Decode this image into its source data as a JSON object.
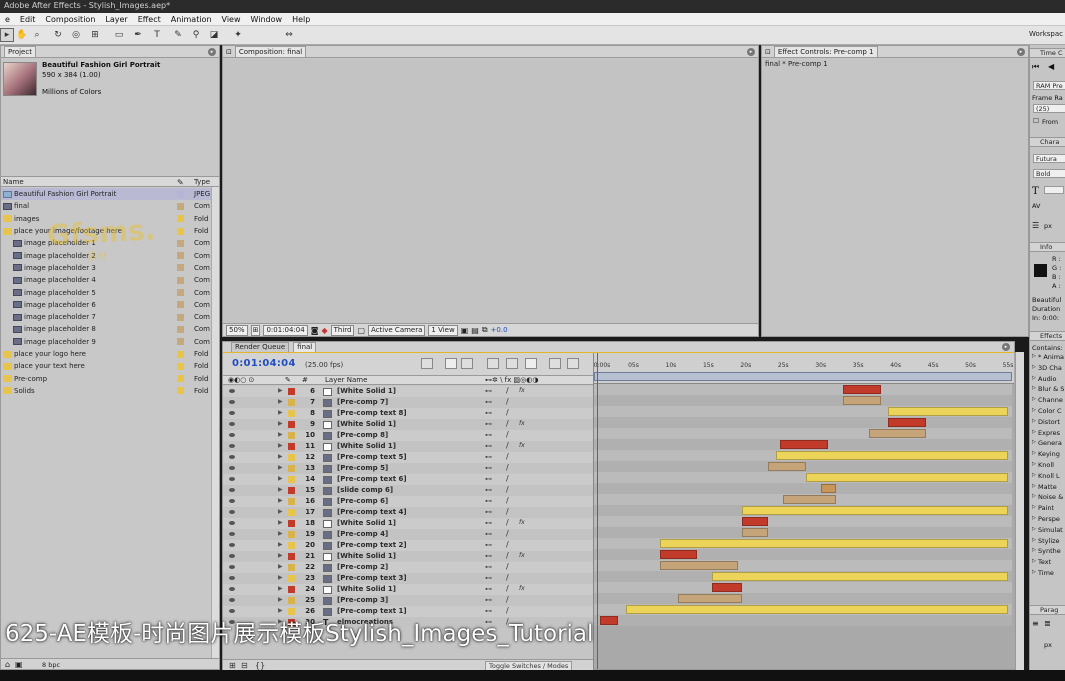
{
  "app": {
    "title": "Adobe After Effects - Stylish_Images.aep*"
  },
  "menu": [
    "e",
    "Edit",
    "Composition",
    "Layer",
    "Effect",
    "Animation",
    "View",
    "Window",
    "Help"
  ],
  "toolbar": {
    "workspace_label": "Workspac"
  },
  "project": {
    "tab": "Project",
    "selected_name": "Beautiful Fashion Girl Portrait",
    "selected_dims": "590 x 384 (1.00)",
    "selected_colors": "Millions of Colors",
    "col_name": "Name",
    "col_type": "Type",
    "bpc": "8 bpc",
    "items": [
      {
        "name": "Beautiful Fashion Girl Portrait",
        "type": "JPEG",
        "kind": "img",
        "indent": 0,
        "label": "#b7b2d8"
      },
      {
        "name": "final",
        "type": "Com",
        "kind": "comp",
        "indent": 0,
        "label": "#c4a87e"
      },
      {
        "name": "images",
        "type": "Fold",
        "kind": "folder",
        "indent": 0,
        "label": "#e8c44a"
      },
      {
        "name": "place your image/footage here",
        "type": "Fold",
        "kind": "folder",
        "indent": 0,
        "label": "#e8c44a"
      },
      {
        "name": "image placeholder 1",
        "type": "Com",
        "kind": "comp",
        "indent": 1,
        "label": "#c4a87e"
      },
      {
        "name": "image placeholder 2",
        "type": "Com",
        "kind": "comp",
        "indent": 1,
        "label": "#c4a87e"
      },
      {
        "name": "image placeholder 3",
        "type": "Com",
        "kind": "comp",
        "indent": 1,
        "label": "#c4a87e"
      },
      {
        "name": "image placeholder 4",
        "type": "Com",
        "kind": "comp",
        "indent": 1,
        "label": "#c4a87e"
      },
      {
        "name": "image placeholder 5",
        "type": "Com",
        "kind": "comp",
        "indent": 1,
        "label": "#c4a87e"
      },
      {
        "name": "image placeholder 6",
        "type": "Com",
        "kind": "comp",
        "indent": 1,
        "label": "#c4a87e"
      },
      {
        "name": "image placeholder 7",
        "type": "Com",
        "kind": "comp",
        "indent": 1,
        "label": "#c4a87e"
      },
      {
        "name": "image placeholder 8",
        "type": "Com",
        "kind": "comp",
        "indent": 1,
        "label": "#c4a87e"
      },
      {
        "name": "image placeholder 9",
        "type": "Com",
        "kind": "comp",
        "indent": 1,
        "label": "#c4a87e"
      },
      {
        "name": "place your logo here",
        "type": "Fold",
        "kind": "folder",
        "indent": 0,
        "label": "#e8c44a"
      },
      {
        "name": "place your text here",
        "type": "Fold",
        "kind": "folder",
        "indent": 0,
        "label": "#e8c44a"
      },
      {
        "name": "Pre-comp",
        "type": "Fold",
        "kind": "folder",
        "indent": 0,
        "label": "#e8c44a"
      },
      {
        "name": "Solids",
        "type": "Fold",
        "kind": "folder",
        "indent": 0,
        "label": "#e8c44a"
      }
    ]
  },
  "watermark": {
    "main": "Gfsms.",
    "sub": "素材"
  },
  "composition": {
    "tab": "Composition: final",
    "zoom": "50%",
    "timecode": "0:01:04:04",
    "resolution": "Third",
    "camera": "Active Camera",
    "views": "1 View",
    "exposure": "+0.0"
  },
  "effect_controls": {
    "tab": "Effect Controls: Pre-comp 1",
    "subtitle": "final * Pre-comp 1"
  },
  "right_panels": {
    "time_controls": "Time C",
    "ram_preview": "RAM Pre",
    "frame_rate_label": "Frame Ra",
    "frame_rate_value": "(25)",
    "from_label": "From",
    "character": "Chara",
    "font": "Futura",
    "style": "Bold",
    "info": "Info",
    "rgba": [
      "R :",
      "G :",
      "B :",
      "A :"
    ],
    "info_name": "Beautiful",
    "info_duration": "Duration",
    "info_in": "In: 0:00:",
    "effects": "Effects",
    "contains": "Contains:",
    "categories": [
      "* Anima",
      "3D Cha",
      "Audio",
      "Blur & S",
      "Channe",
      "Color C",
      "Distort",
      "Expres",
      "Genera",
      "Keying",
      "Knoll",
      "Knoll L",
      "Matte",
      "Noise &",
      "Paint",
      "Perspe",
      "Simulat",
      "Stylize",
      "Synthe",
      "Text",
      "Time"
    ],
    "paragraph": "Parag",
    "px_values": [
      "px",
      "px"
    ]
  },
  "timeline": {
    "tabs": [
      "Render Queue",
      "final"
    ],
    "timecode": "0:01:04:04",
    "fps": "(25.00 fps)",
    "col_number": "#",
    "col_layer": "Layer Name",
    "toggle": "Toggle Switches / Modes",
    "ruler": [
      "0:00s",
      "05s",
      "10s",
      "15s",
      "20s",
      "25s",
      "30s",
      "35s",
      "40s",
      "45s",
      "50s",
      "55s"
    ],
    "layers": [
      {
        "num": "6",
        "name": "[White Solid 1]",
        "type": "solid",
        "fx": true,
        "label": "#c23a2a",
        "bar": [
          33,
          38
        ],
        "barColor": "#c23a2a"
      },
      {
        "num": "7",
        "name": "[Pre-comp 7]",
        "type": "comp",
        "fx": false,
        "label": "#d9b24a",
        "bar": [
          33,
          38
        ],
        "barColor": "#c6a47a"
      },
      {
        "num": "8",
        "name": "[Pre-comp text 8]",
        "type": "comp",
        "fx": false,
        "label": "#e8c44a",
        "bar": [
          39,
          55
        ],
        "barColor": "#ecd35a"
      },
      {
        "num": "9",
        "name": "[White Solid 1]",
        "type": "solid",
        "fx": true,
        "label": "#c23a2a",
        "bar": [
          39,
          44
        ],
        "barColor": "#c23a2a"
      },
      {
        "num": "10",
        "name": "[Pre-comp 8]",
        "type": "comp",
        "fx": false,
        "label": "#d9b24a",
        "bar": [
          36.5,
          44
        ],
        "barColor": "#c6a47a"
      },
      {
        "num": "11",
        "name": "[White Solid 1]",
        "type": "solid",
        "fx": true,
        "label": "#c23a2a",
        "bar": [
          24.5,
          31
        ],
        "barColor": "#c23a2a"
      },
      {
        "num": "12",
        "name": "[Pre-comp text 5]",
        "type": "comp",
        "fx": false,
        "label": "#e8c44a",
        "bar": [
          24,
          55
        ],
        "barColor": "#ecd35a"
      },
      {
        "num": "13",
        "name": "[Pre-comp 5]",
        "type": "comp",
        "fx": false,
        "label": "#d9b24a",
        "bar": [
          23,
          28
        ],
        "barColor": "#c6a47a"
      },
      {
        "num": "14",
        "name": "[Pre-comp text 6]",
        "type": "comp",
        "fx": false,
        "label": "#e8c44a",
        "bar": [
          28,
          55
        ],
        "barColor": "#ecd35a"
      },
      {
        "num": "15",
        "name": "[slide comp 6]",
        "type": "comp",
        "fx": false,
        "label": "#c23a2a",
        "bar": [
          30,
          32
        ],
        "barColor": "#c8955a"
      },
      {
        "num": "16",
        "name": "[Pre-comp 6]",
        "type": "comp",
        "fx": false,
        "label": "#d9b24a",
        "bar": [
          25,
          32
        ],
        "barColor": "#c6a47a"
      },
      {
        "num": "17",
        "name": "[Pre-comp text 4]",
        "type": "comp",
        "fx": false,
        "label": "#e8c44a",
        "bar": [
          19.5,
          55
        ],
        "barColor": "#ecd35a"
      },
      {
        "num": "18",
        "name": "[White Solid 1]",
        "type": "solid",
        "fx": true,
        "label": "#c23a2a",
        "bar": [
          19.5,
          23
        ],
        "barColor": "#c23a2a"
      },
      {
        "num": "19",
        "name": "[Pre-comp 4]",
        "type": "comp",
        "fx": false,
        "label": "#d9b24a",
        "bar": [
          19.5,
          23
        ],
        "barColor": "#c6a47a"
      },
      {
        "num": "20",
        "name": "[Pre-comp text 2]",
        "type": "comp",
        "fx": false,
        "label": "#e8c44a",
        "bar": [
          8.5,
          55
        ],
        "barColor": "#ecd35a"
      },
      {
        "num": "21",
        "name": "[White Solid 1]",
        "type": "solid",
        "fx": true,
        "label": "#c23a2a",
        "bar": [
          8.5,
          13.5
        ],
        "barColor": "#c23a2a"
      },
      {
        "num": "22",
        "name": "[Pre-comp 2]",
        "type": "comp",
        "fx": false,
        "label": "#d9b24a",
        "bar": [
          8.5,
          19
        ],
        "barColor": "#c6a47a"
      },
      {
        "num": "23",
        "name": "[Pre-comp text 3]",
        "type": "comp",
        "fx": false,
        "label": "#e8c44a",
        "bar": [
          15.5,
          55
        ],
        "barColor": "#ecd35a"
      },
      {
        "num": "24",
        "name": "[White Solid 1]",
        "type": "solid",
        "fx": true,
        "label": "#c23a2a",
        "bar": [
          15.5,
          19.5
        ],
        "barColor": "#c23a2a"
      },
      {
        "num": "25",
        "name": "[Pre-comp 3]",
        "type": "comp",
        "fx": false,
        "label": "#d9b24a",
        "bar": [
          11,
          19.5
        ],
        "barColor": "#c6a47a"
      },
      {
        "num": "26",
        "name": "[Pre-comp text 1]",
        "type": "comp",
        "fx": false,
        "label": "#e8c44a",
        "bar": [
          4,
          55
        ],
        "barColor": "#ecd35a"
      },
      {
        "num": "30",
        "name": "elmocreations",
        "type": "text",
        "fx": false,
        "label": "#c23a2a",
        "bar": [
          0.5,
          3
        ],
        "barColor": "#c23a2a"
      }
    ],
    "max_seconds": 55
  },
  "caption": "625-AE模板-时尚图片展示模板Stylish_Images_Tutorial",
  "colors": {
    "accent": "#e3b629",
    "timecode": "#1f4ec2",
    "cti": "#3a66c4"
  }
}
